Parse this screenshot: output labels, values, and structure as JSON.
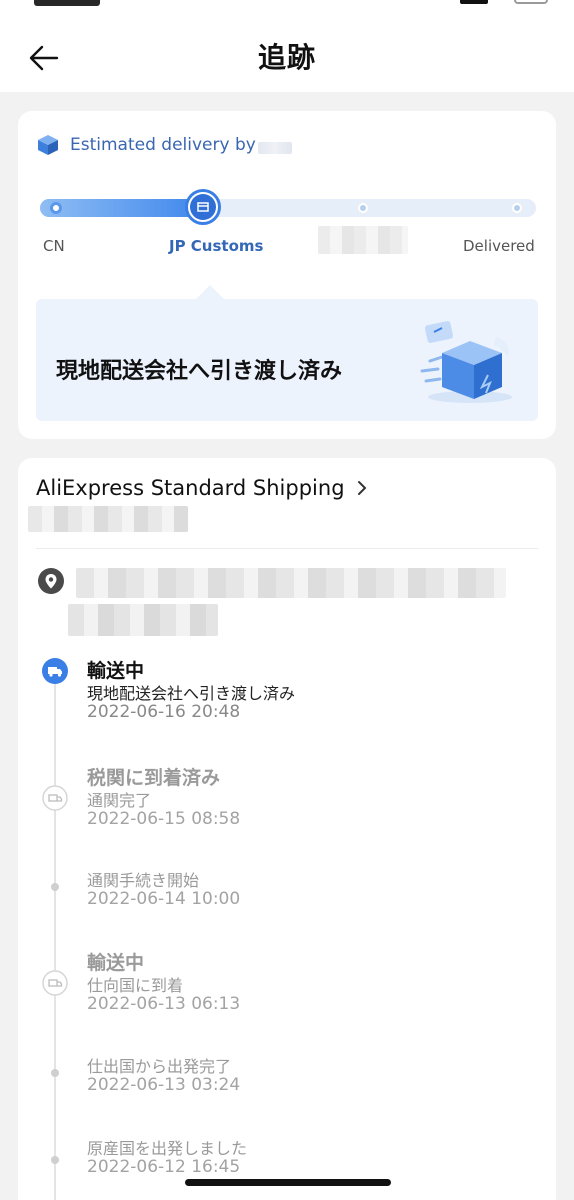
{
  "header": {
    "title": "追跡"
  },
  "delivery": {
    "estimated_label": "Estimated delivery by",
    "progress_fraction": 0.35,
    "stages": [
      {
        "label": "CN"
      },
      {
        "label": "JP Customs"
      },
      {
        "label": ""
      },
      {
        "label": "Delivered"
      }
    ],
    "current_status": "現地配送会社へ引き渡し済み"
  },
  "shipping": {
    "method": "AliExpress Standard Shipping"
  },
  "timeline": [
    {
      "title": "輸送中",
      "desc": "現地配送会社へ引き渡し済み",
      "time": "2022-06-16 20:48"
    },
    {
      "title": "税関に到着済み",
      "desc": "通関完了",
      "time": "2022-06-15 08:58"
    },
    {
      "title": "",
      "desc": "通関手続き開始",
      "time": "2022-06-14 10:00"
    },
    {
      "title": "輸送中",
      "desc": "仕向国に到着",
      "time": "2022-06-13 06:13"
    },
    {
      "title": "",
      "desc": "仕出国から出発完了",
      "time": "2022-06-13 03:24"
    },
    {
      "title": "",
      "desc": "原産国を出発しました",
      "time": "2022-06-12 16:45"
    }
  ],
  "colors": {
    "accent": "#3a7fe6",
    "accent_text": "#3468b7",
    "background": "#f2f2f2"
  }
}
